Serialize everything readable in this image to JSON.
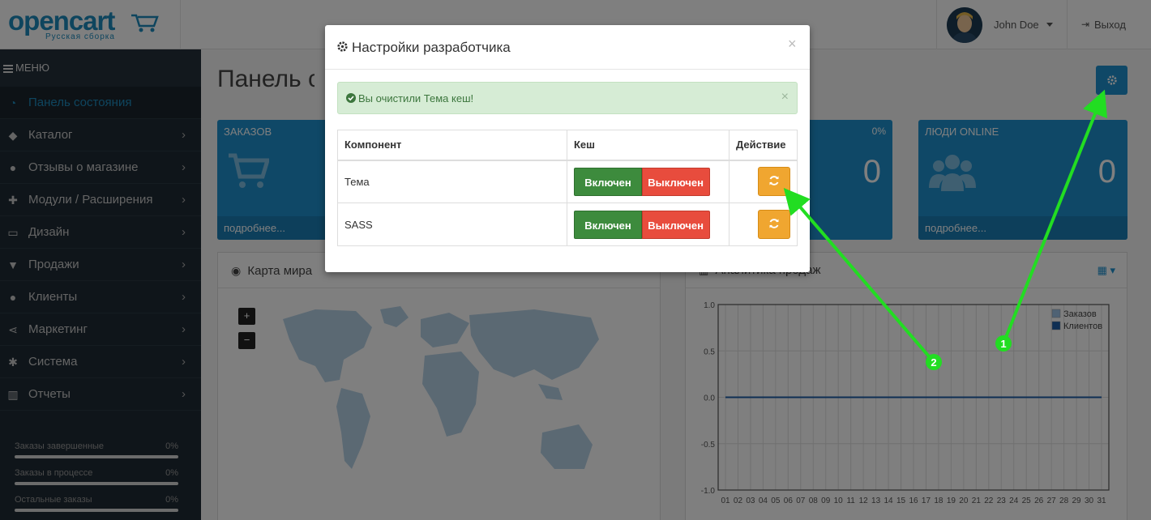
{
  "header": {
    "brand": "opencart",
    "brand_sub": "Русская сборка",
    "user_name": "John Doe",
    "logout_label": "Выход"
  },
  "sidebar": {
    "menu_label": "МЕНЮ",
    "items": [
      {
        "label": "Панель состояния",
        "icon": "dashboard-icon",
        "active": true
      },
      {
        "label": "Каталог",
        "icon": "tag-icon"
      },
      {
        "label": "Отзывы о магазине",
        "icon": "comments-icon"
      },
      {
        "label": "Модули / Расширения",
        "icon": "puzzle-icon"
      },
      {
        "label": "Дизайн",
        "icon": "desktop-icon"
      },
      {
        "label": "Продажи",
        "icon": "cart-icon"
      },
      {
        "label": "Клиенты",
        "icon": "user-icon"
      },
      {
        "label": "Маркетинг",
        "icon": "share-icon"
      },
      {
        "label": "Система",
        "icon": "cog-icon"
      },
      {
        "label": "Отчеты",
        "icon": "bar-chart-icon"
      }
    ],
    "progress": [
      {
        "label": "Заказы завершенные",
        "value": "0%",
        "fraction": 0
      },
      {
        "label": "Заказы в процессе",
        "value": "0%",
        "fraction": 0
      },
      {
        "label": "Остальные заказы",
        "value": "0%",
        "fraction": 0
      }
    ]
  },
  "main": {
    "page_title": "Панель состояния",
    "tiles": [
      {
        "title": "ЗАКАЗОВ",
        "footer": "подробнее..."
      },
      {
        "percent": "0%",
        "value": "0"
      },
      {
        "title": "ЛЮДИ ONLINE",
        "value": "0",
        "footer": "подробнее..."
      }
    ],
    "map_title": "Карта мира",
    "map_zoom_in": "+",
    "map_zoom_out": "−",
    "sales_title": "Аналитика продаж"
  },
  "chart_data": {
    "type": "line",
    "x": [
      "01",
      "02",
      "03",
      "04",
      "05",
      "06",
      "07",
      "08",
      "09",
      "10",
      "11",
      "12",
      "13",
      "14",
      "15",
      "16",
      "17",
      "18",
      "19",
      "20",
      "21",
      "22",
      "23",
      "24",
      "25",
      "26",
      "27",
      "28",
      "29",
      "30",
      "31"
    ],
    "series": [
      {
        "name": "Заказов",
        "values": [
          0,
          0,
          0,
          0,
          0,
          0,
          0,
          0,
          0,
          0,
          0,
          0,
          0,
          0,
          0,
          0,
          0,
          0,
          0,
          0,
          0,
          0,
          0,
          0,
          0,
          0,
          0,
          0,
          0,
          0,
          0
        ],
        "color": "#9fc5e8"
      },
      {
        "name": "Клиентов",
        "values": [
          0,
          0,
          0,
          0,
          0,
          0,
          0,
          0,
          0,
          0,
          0,
          0,
          0,
          0,
          0,
          0,
          0,
          0,
          0,
          0,
          0,
          0,
          0,
          0,
          0,
          0,
          0,
          0,
          0,
          0,
          0
        ],
        "color": "#1f5fa8"
      }
    ],
    "yticks": [
      "1.0",
      "0.5",
      "0.0",
      "-0.5",
      "-1.0"
    ],
    "ylim": [
      -1,
      1
    ],
    "grid": true,
    "legend": "top-right"
  },
  "modal": {
    "title": "Настройки разработчика",
    "alert": "Вы очистили Тема кеш!",
    "columns": [
      "Компонент",
      "Кеш",
      "Действие"
    ],
    "rows": [
      {
        "component": "Тема",
        "on": "Включен",
        "off": "Выключен"
      },
      {
        "component": "SASS",
        "on": "Включен",
        "off": "Выключен"
      }
    ]
  },
  "annotations": {
    "marker1": "1",
    "marker2": "2",
    "color": "#22dd22"
  },
  "colors": {
    "primary": "#1e91cf",
    "success": "#3d8b3d",
    "danger": "#e84c3d",
    "warning": "#f0a630",
    "sidebar": "#1f2b35"
  }
}
